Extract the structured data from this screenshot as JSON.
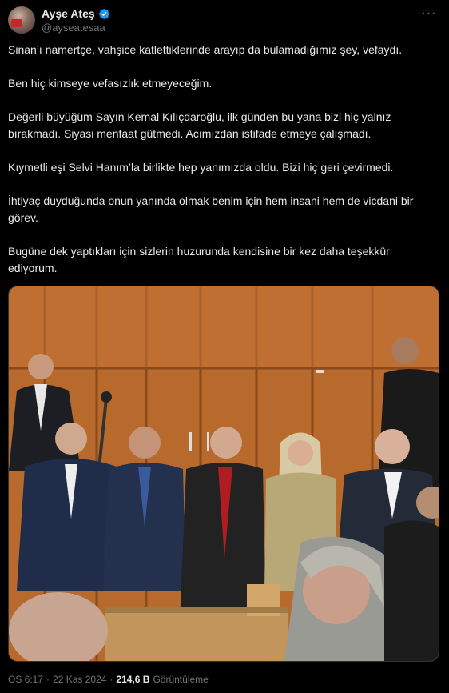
{
  "author": {
    "display_name": "Ayşe Ateş",
    "handle": "@ayseatesaa"
  },
  "more_label": "···",
  "tweet": {
    "paragraphs": [
      "Sinan’ı namertçe, vahşice katlettiklerinde arayıp da bulamadığımız şey, vefaydı.",
      "Ben hiç kimseye vefasızlık etmeyeceğim.",
      "Değerli büyüğüm Sayın Kemal Kılıçdaroğlu, ilk günden bu yana bizi hiç yalnız bırakmadı. Siyasi menfaat gütmedi. Acımızdan istifade etmeye çalışmadı.",
      "Kıymetli eşi Selvi Hanım’la birlikte hep yanımızda oldu. Bizi hiç geri çevirmedi.",
      "İhtiyaç duyduğunda onun yanında olmak benim için hem insani hem de vicdani bir görev.",
      "Bugüne dek yaptıkları için sizlerin huzurunda kendisine bir kez daha teşekkür ediyorum."
    ]
  },
  "meta": {
    "time": "ÖS 6:17",
    "separator": "·",
    "date": "22 Kas 2024",
    "views_count": "214,6 B",
    "views_label": "Görüntüleme"
  },
  "colors": {
    "background": "#000000",
    "text": "#e7e9ea",
    "secondary": "#71767b",
    "verified": "#1d9bf0"
  }
}
